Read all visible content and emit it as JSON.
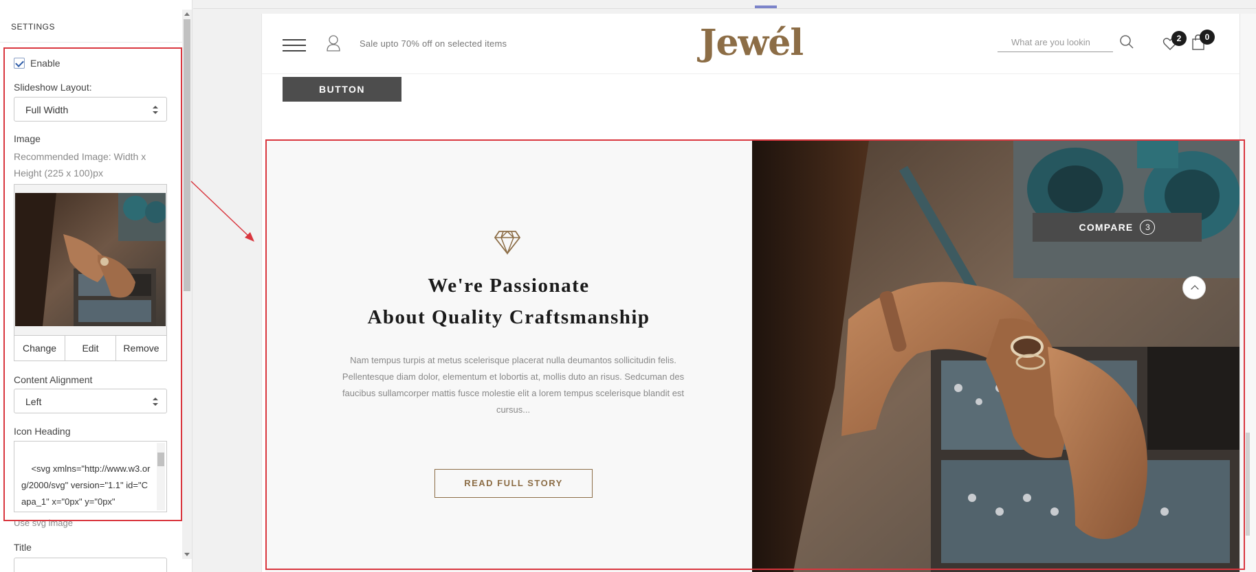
{
  "panel": {
    "header": "SETTINGS",
    "enable_label": "Enable",
    "enable_checked": true,
    "slideshow_layout_label": "Slideshow Layout:",
    "slideshow_layout_value": "Full Width",
    "image_label": "Image",
    "image_hint_line1": "Recommended Image: Width x",
    "image_hint_line2": "Height (225 x 100)px",
    "image_actions": {
      "change": "Change",
      "edit": "Edit",
      "remove": "Remove"
    },
    "content_alignment_label": "Content Alignment",
    "content_alignment_value": "Left",
    "icon_heading_label": "Icon Heading",
    "icon_heading_value": "<svg xmlns=\"http://www.w3.org/2000/svg\" version=\"1.1\" id=\"Capa_1\" x=\"0px\" y=\"0px\"",
    "use_svg_hint": "Use svg image",
    "title_label": "Title"
  },
  "site": {
    "promo": "Sale upto 70% off on selected items",
    "logo": "Jewél",
    "search_placeholder": "What are you lookin",
    "wishlist_count": "2",
    "cart_count": "0",
    "button_label": "BUTTON",
    "hero": {
      "title_line1": "We're Passionate",
      "title_line2": "About Quality Craftsmanship",
      "text": "Nam tempus turpis at metus scelerisque placerat nulla deumantos sollicitudin felis. Pellentesque diam dolor, elementum et lobortis at, mollis duto an risus. Sedcuman des faucibus sullamcorper mattis fusce molestie elit a lorem tempus scelerisque blandit est cursus...",
      "cta": "READ FULL STORY"
    },
    "compare_label": "COMPARE",
    "compare_count": "3"
  },
  "colors": {
    "brand": "#8c6d46",
    "highlight": "#d9363e",
    "dark_button": "#4d4d4d"
  }
}
